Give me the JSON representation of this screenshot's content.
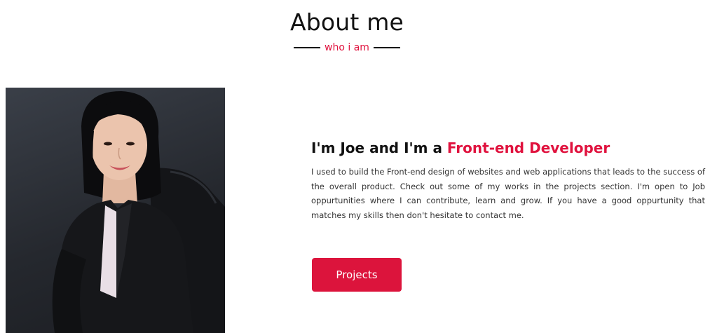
{
  "about": {
    "title": "About me",
    "subtitle": "who i am"
  },
  "profile": {
    "headline_prefix": "I'm Joe and I'm a ",
    "headline_accent": "Front-end Developer",
    "bio": "I used to build the Front-end design of websites and web applications that leads to the success of the overall product. Check out some of my works in the projects section. I'm open to Job oppurtunities where I can contribute, learn and grow. If you have a good oppurtunity that matches my skills then don't hesitate to contact me.",
    "button_label": "Projects"
  },
  "colors": {
    "accent": "#dc143c",
    "heading": "#111111",
    "body_text": "#333333"
  },
  "icons": {
    "photo": "profile-photo"
  }
}
